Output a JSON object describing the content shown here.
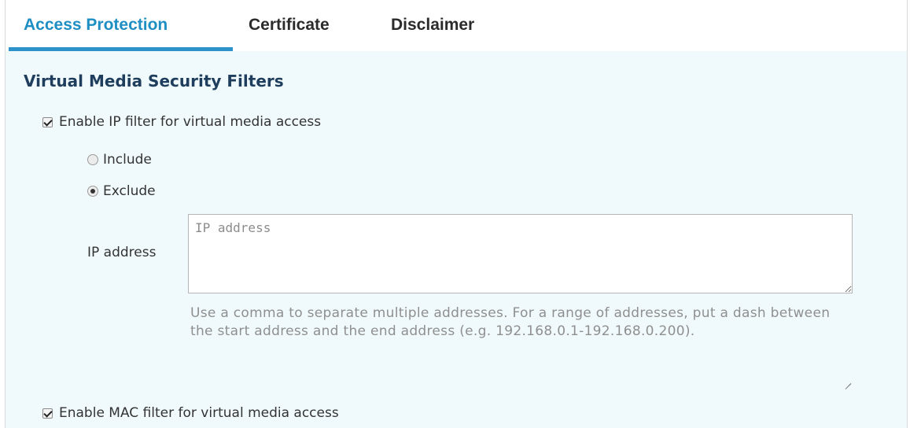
{
  "tabs": [
    {
      "label": "Access Protection",
      "active": true
    },
    {
      "label": "Certificate",
      "active": false
    },
    {
      "label": "Disclaimer",
      "active": false
    }
  ],
  "section": {
    "title": "Virtual Media Security Filters"
  },
  "ip_filter": {
    "checkbox_label": "Enable IP filter for virtual media access",
    "checked": true,
    "mode_options": [
      {
        "label": "Include",
        "selected": false
      },
      {
        "label": "Exclude",
        "selected": true
      }
    ],
    "field_label": "IP address",
    "field_placeholder": "IP address",
    "field_value": "",
    "help_text": "Use a comma to separate multiple addresses. For a range of addresses, put a dash between the start address and the end address (e.g. 192.168.0.1-192.168.0.200)."
  },
  "mac_filter": {
    "checkbox_label": "Enable MAC filter for virtual media access",
    "checked": true
  },
  "colors": {
    "accent": "#2b93c9",
    "active_tab_text": "#1f8ec3",
    "panel_background": "#f0fafc",
    "section_title": "#1f3d5c",
    "help_text": "#8f8f8f"
  },
  "icons": {
    "checkbox": "checkbox-checked-icon",
    "radio_on": "radio-selected-icon",
    "radio_off": "radio-unselected-icon",
    "resize": "resize-grip-icon"
  }
}
